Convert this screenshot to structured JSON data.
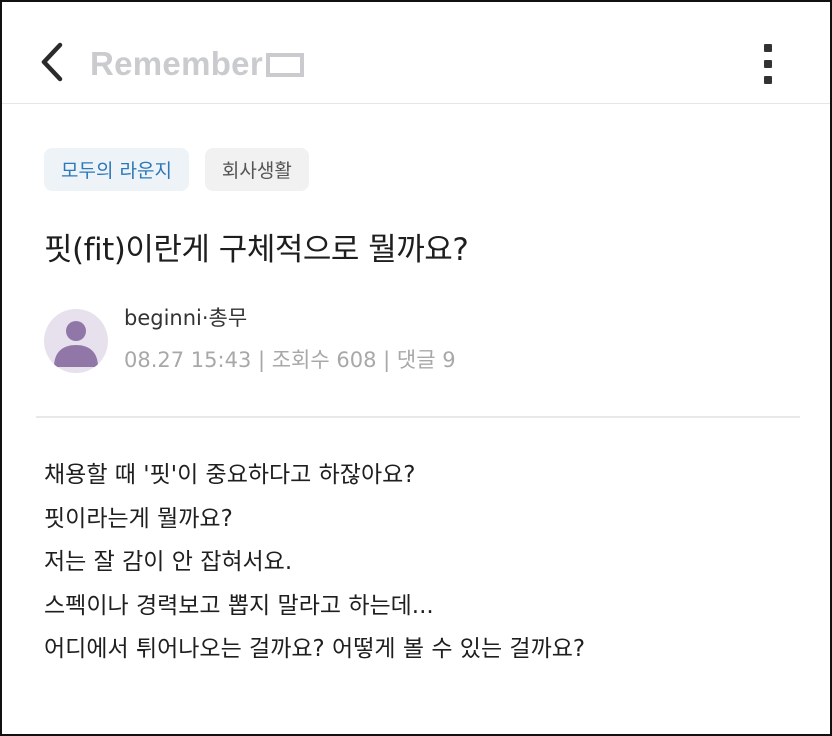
{
  "header": {
    "brand": "Remember",
    "back_icon": "chevron-left-icon",
    "menu_icon": "more-vertical-icon"
  },
  "post": {
    "tags": [
      "모두의 라운지",
      "회사생활"
    ],
    "title": "핏(fit)이란게 구체적으로 뭘까요?",
    "author": "beginni·총무",
    "meta": "08.27 15:43 | 조회수 608 | 댓글 9",
    "body_lines": [
      "채용할 때 '핏'이 중요하다고 하잖아요?",
      "핏이라는게 뭘까요?",
      "저는 잘 감이 안 잡혀서요.",
      "스펙이나 경력보고 뽑지 말라고 하는데...",
      "어디에서 튀어나오는 걸까요? 어떻게 볼 수 있는 걸까요?"
    ]
  },
  "colors": {
    "accent": "#2c78b8",
    "tag_primary_bg": "#eef3f8",
    "tag_secondary_bg": "#f1f1f1",
    "avatar_bg": "#e7e1ee",
    "avatar_fg": "#9077a8",
    "meta_text": "#a8a8a8"
  }
}
